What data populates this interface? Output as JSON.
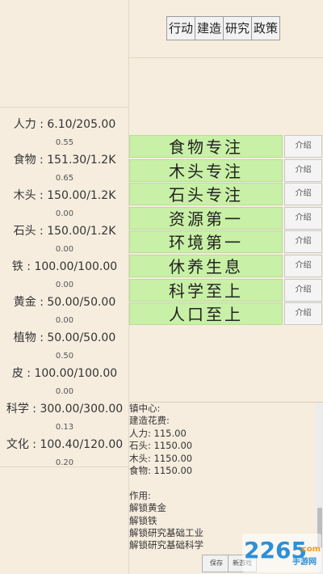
{
  "tabs": [
    "行动",
    "建造",
    "研究",
    "政策"
  ],
  "resources": [
    {
      "label": "人力 : 6.10/205.00",
      "rate": "0.55"
    },
    {
      "label": "食物 : 151.30/1.2K",
      "rate": "0.65"
    },
    {
      "label": "木头 : 150.00/1.2K",
      "rate": "0.00"
    },
    {
      "label": "石头 : 150.00/1.2K",
      "rate": "0.00"
    },
    {
      "label": "铁 : 100.00/100.00",
      "rate": "0.00"
    },
    {
      "label": "黄金 : 50.00/50.00",
      "rate": "0.00"
    },
    {
      "label": "植物 : 50.00/50.00",
      "rate": "0.50"
    },
    {
      "label": "皮 : 100.00/100.00",
      "rate": "0.00"
    },
    {
      "label": "科学 : 300.00/300.00",
      "rate": "0.13"
    },
    {
      "label": "文化 : 100.40/120.00",
      "rate": "0.20"
    }
  ],
  "policies": [
    {
      "label": "食物专注",
      "intro": "介绍"
    },
    {
      "label": "木头专注",
      "intro": "介绍"
    },
    {
      "label": "石头专注",
      "intro": "介绍"
    },
    {
      "label": "资源第一",
      "intro": "介绍"
    },
    {
      "label": "环境第一",
      "intro": "介绍"
    },
    {
      "label": "休养生息",
      "intro": "介绍"
    },
    {
      "label": "科学至上",
      "intro": "介绍"
    },
    {
      "label": "人口至上",
      "intro": "介绍"
    }
  ],
  "info": {
    "lines": [
      "镇中心:",
      "建造花费:",
      "人力: 115.00",
      "石头: 1150.00",
      "木头: 1150.00",
      "食物: 1150.00",
      "",
      "作用:",
      "解锁黄金",
      "解锁铁",
      "解锁研究基础工业",
      "解锁研究基础科学"
    ]
  },
  "bottom_buttons": {
    "save": "保存",
    "new_game": "新游戏"
  },
  "watermark": {
    "number": "2265",
    "suffix": ".com",
    "site": "手游网"
  },
  "colors": {
    "background": "#f6eddf",
    "policy_green": "#c8f0a6",
    "watermark_blue": "#2d8fd8",
    "watermark_orange": "#f39a1e"
  }
}
